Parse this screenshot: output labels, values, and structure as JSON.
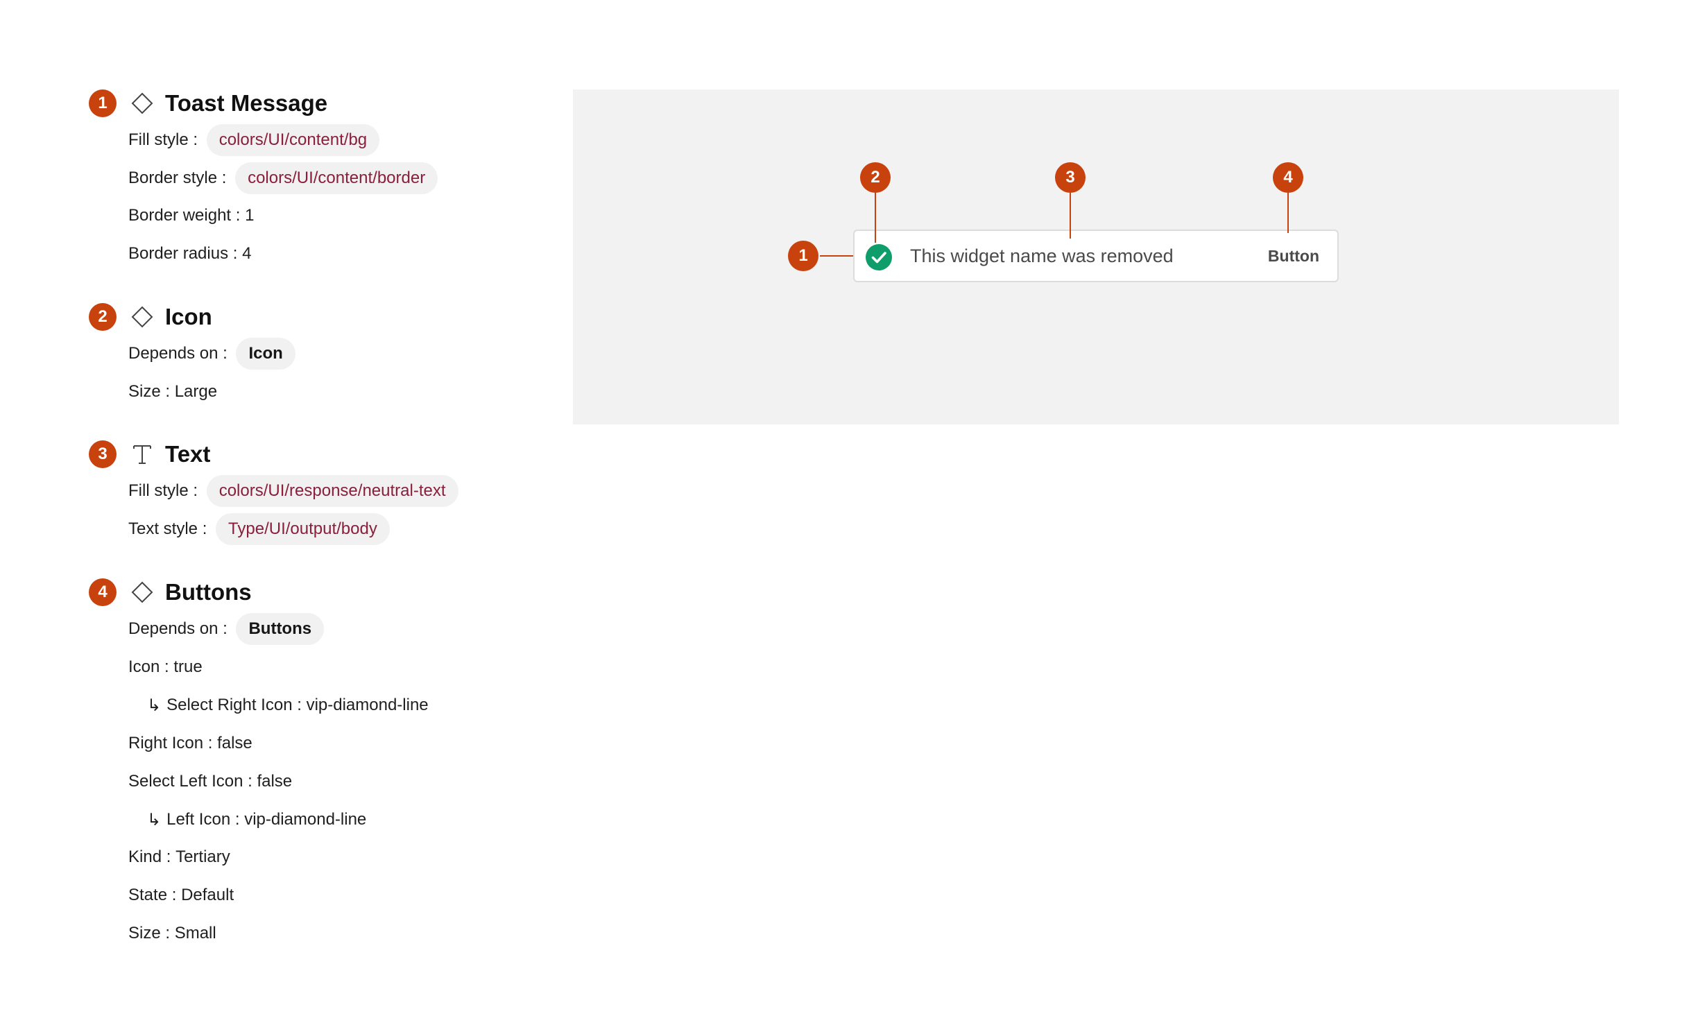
{
  "colors": {
    "accent": "#c8420e",
    "chip_bg": "#f1f1f1",
    "chip_text": "#8a1f3c",
    "canvas_bg": "#f2f2f2",
    "success": "#0f9d6b"
  },
  "spec": {
    "toast": {
      "number": "1",
      "icon": "diamond-icon",
      "title": "Toast Message",
      "fill_key": "Fill style",
      "fill_val": "colors/UI/content/bg",
      "border_key": "Border style",
      "border_val": "colors/UI/content/border",
      "weight_key": "Border weight",
      "weight_val": "1",
      "radius_key": "Border radius",
      "radius_val": "4"
    },
    "icon": {
      "number": "2",
      "icon": "diamond-icon",
      "title": "Icon",
      "depends_key": "Depends on",
      "depends_val": "Icon",
      "size_key": "Size",
      "size_val": "Large"
    },
    "text": {
      "number": "3",
      "icon": "text-t-icon",
      "title": "Text",
      "fill_key": "Fill style",
      "fill_val": "colors/UI/response/neutral-text",
      "style_key": "Text style",
      "style_val": "Type/UI/output/body"
    },
    "buttons": {
      "number": "4",
      "icon": "diamond-icon",
      "title": "Buttons",
      "depends_key": "Depends on",
      "depends_val": "Buttons",
      "icon_key": "Icon",
      "icon_val": "true",
      "right_sel_key": "Select Right Icon",
      "right_sel_val": "vip-diamond-line",
      "right_icon_key": "Right Icon",
      "right_icon_val": "false",
      "left_sel_key": "Select Left Icon",
      "left_sel_val": "false",
      "left_icon_key": "Left Icon",
      "left_icon_val": "vip-diamond-line",
      "kind_key": "Kind",
      "kind_val": "Tertiary",
      "state_key": "State",
      "state_val": "Default",
      "size_key": "Size",
      "size_val": "Small"
    }
  },
  "separator": " : ",
  "sub_arrow": "↳",
  "preview": {
    "toast_icon": "check-circle-icon",
    "toast_text": "This widget name was removed",
    "toast_button": "Button",
    "callouts": [
      "1",
      "2",
      "3",
      "4"
    ]
  }
}
